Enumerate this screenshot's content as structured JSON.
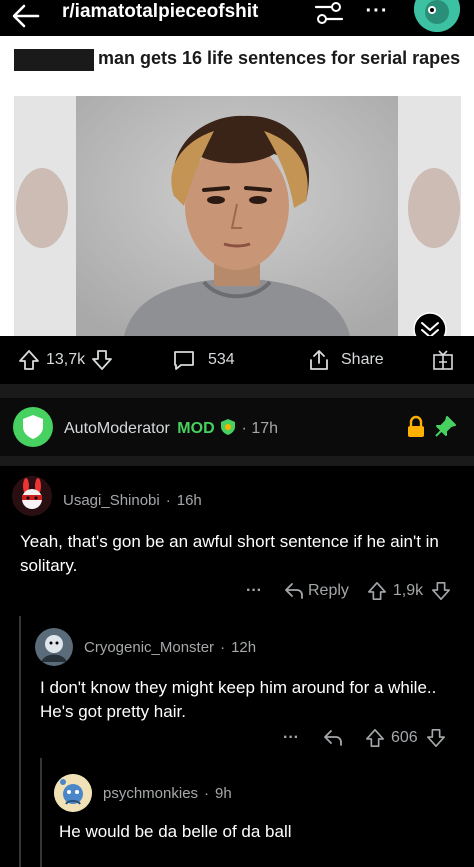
{
  "topbar": {
    "subreddit": "r/iamatotalpieceofshit",
    "more_label": "···"
  },
  "post": {
    "headline": "man gets 16 life sentences for serial rapes",
    "votes": "13,7k",
    "comments": "534",
    "share_label": "Share"
  },
  "automod": {
    "username": "AutoModerator",
    "badge": "MOD",
    "time": "17h"
  },
  "comments": [
    {
      "username": "Usagi_Shinobi",
      "time": "16h",
      "body": "Yeah, that's gon be an awful short sentence if he ain't in solitary.",
      "reply_label": "Reply",
      "votes": "1,9k",
      "more": "···"
    },
    {
      "username": "Cryogenic_Monster",
      "time": "12h",
      "body": "I don't know they might keep him around for a while.. He's got pretty hair.",
      "votes": "606",
      "more": "···"
    },
    {
      "username": "psychmonkies",
      "time": "9h",
      "body": "He would be da belle of da ball"
    }
  ],
  "colors": {
    "mod_green": "#46d160",
    "lock_orange": "#ffb000",
    "background": "#000000",
    "text": "#d7dadc",
    "meta": "#a5a8aa"
  }
}
